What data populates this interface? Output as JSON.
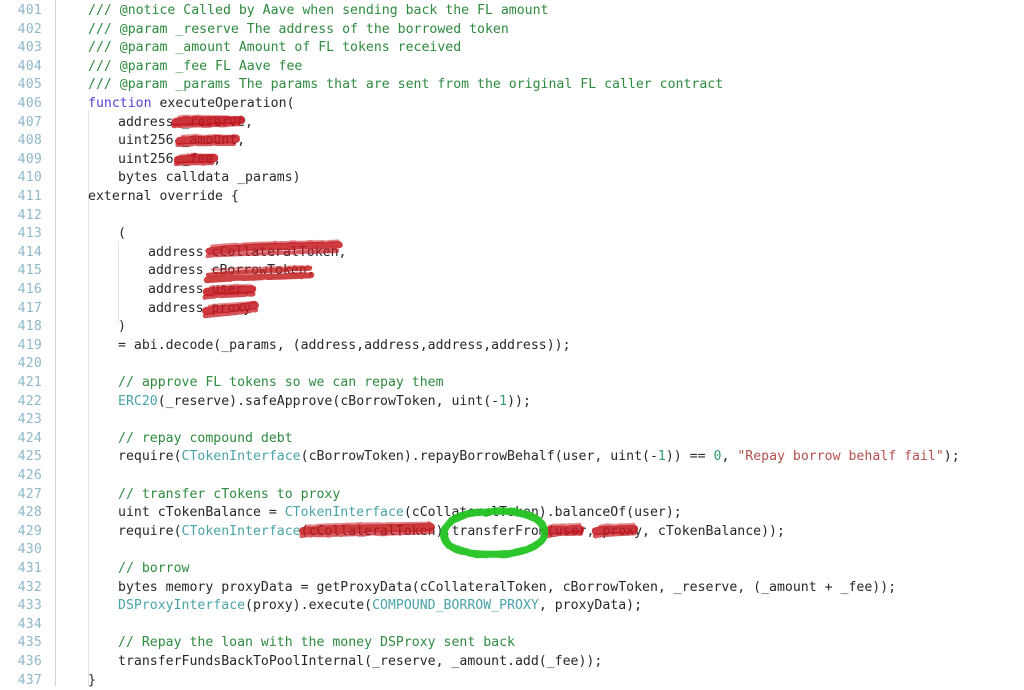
{
  "viewer": {
    "kind": "code-diff-viewer",
    "language": "solidity",
    "first_line_number": 401,
    "last_line_number": 437,
    "colors": {
      "background": "#ffffff",
      "line_number": "#8fb8c9",
      "gutter_border": "#cfd3d6",
      "indent_guide": "#e2e4e6",
      "text": "#24292e",
      "comment": "#2e8b3f",
      "keyword": "#5145d6",
      "type": "#4aa3a8",
      "string": "#b5514f",
      "number": "#2f9e6e",
      "annotation_red": "#c4161c",
      "annotation_green": "#22c522"
    }
  },
  "lines": [
    {
      "no": "401",
      "indent": 1,
      "tokens": [
        {
          "t": "/// @notice Called by Aave when sending back the FL amount",
          "c": "comment"
        }
      ]
    },
    {
      "no": "402",
      "indent": 1,
      "tokens": [
        {
          "t": "/// @param _reserve The address of the borrowed token",
          "c": "comment"
        }
      ]
    },
    {
      "no": "403",
      "indent": 1,
      "tokens": [
        {
          "t": "/// @param _amount Amount of FL tokens received",
          "c": "comment"
        }
      ]
    },
    {
      "no": "404",
      "indent": 1,
      "tokens": [
        {
          "t": "/// @param _fee FL Aave fee",
          "c": "comment"
        }
      ]
    },
    {
      "no": "405",
      "indent": 1,
      "tokens": [
        {
          "t": "/// @param _params The params that are sent from the original FL caller contract",
          "c": "comment"
        }
      ]
    },
    {
      "no": "406",
      "indent": 1,
      "tokens": [
        {
          "t": "function",
          "c": "keyword"
        },
        {
          "t": " executeOperation(",
          "c": "plain"
        }
      ]
    },
    {
      "no": "407",
      "indent": 2,
      "tokens": [
        {
          "t": "address _reserve,",
          "c": "plain"
        }
      ]
    },
    {
      "no": "408",
      "indent": 2,
      "tokens": [
        {
          "t": "uint256 _amount,",
          "c": "plain"
        }
      ]
    },
    {
      "no": "409",
      "indent": 2,
      "tokens": [
        {
          "t": "uint256 _fee,",
          "c": "plain"
        }
      ]
    },
    {
      "no": "410",
      "indent": 2,
      "tokens": [
        {
          "t": "bytes calldata _params)",
          "c": "plain"
        }
      ]
    },
    {
      "no": "411",
      "indent": 1,
      "tokens": [
        {
          "t": "external override {",
          "c": "plain"
        }
      ]
    },
    {
      "no": "412",
      "indent": 0,
      "tokens": []
    },
    {
      "no": "413",
      "indent": 2,
      "tokens": [
        {
          "t": "(",
          "c": "plain"
        }
      ]
    },
    {
      "no": "414",
      "indent": 3,
      "tokens": [
        {
          "t": "address cCollateralToken,",
          "c": "plain"
        }
      ]
    },
    {
      "no": "415",
      "indent": 3,
      "tokens": [
        {
          "t": "address cBorrowToken,",
          "c": "plain"
        }
      ]
    },
    {
      "no": "416",
      "indent": 3,
      "tokens": [
        {
          "t": "address user,",
          "c": "plain"
        }
      ]
    },
    {
      "no": "417",
      "indent": 3,
      "tokens": [
        {
          "t": "address proxy",
          "c": "plain"
        }
      ]
    },
    {
      "no": "418",
      "indent": 2,
      "tokens": [
        {
          "t": ")",
          "c": "plain"
        }
      ]
    },
    {
      "no": "419",
      "indent": 2,
      "tokens": [
        {
          "t": "= abi.decode(_params, (address,address,address,address));",
          "c": "plain"
        }
      ]
    },
    {
      "no": "420",
      "indent": 0,
      "tokens": []
    },
    {
      "no": "421",
      "indent": 2,
      "tokens": [
        {
          "t": "// approve FL tokens so we can repay them",
          "c": "comment"
        }
      ]
    },
    {
      "no": "422",
      "indent": 2,
      "tokens": [
        {
          "t": "ERC20",
          "c": "type"
        },
        {
          "t": "(_reserve).safeApprove(cBorrowToken, uint(-",
          "c": "plain"
        },
        {
          "t": "1",
          "c": "number"
        },
        {
          "t": "));",
          "c": "plain"
        }
      ]
    },
    {
      "no": "423",
      "indent": 0,
      "tokens": []
    },
    {
      "no": "424",
      "indent": 2,
      "tokens": [
        {
          "t": "// repay compound debt",
          "c": "comment"
        }
      ]
    },
    {
      "no": "425",
      "indent": 2,
      "tokens": [
        {
          "t": "require(",
          "c": "plain"
        },
        {
          "t": "CTokenInterface",
          "c": "type"
        },
        {
          "t": "(cBorrowToken).repayBorrowBehalf(user, uint(-",
          "c": "plain"
        },
        {
          "t": "1",
          "c": "number"
        },
        {
          "t": ")) == ",
          "c": "plain"
        },
        {
          "t": "0",
          "c": "number"
        },
        {
          "t": ", ",
          "c": "plain"
        },
        {
          "t": "\"Repay borrow behalf fail\"",
          "c": "string"
        },
        {
          "t": ");",
          "c": "plain"
        }
      ]
    },
    {
      "no": "426",
      "indent": 0,
      "tokens": []
    },
    {
      "no": "427",
      "indent": 2,
      "tokens": [
        {
          "t": "// transfer cTokens to proxy",
          "c": "comment"
        }
      ]
    },
    {
      "no": "428",
      "indent": 2,
      "tokens": [
        {
          "t": "uint cTokenBalance = ",
          "c": "plain"
        },
        {
          "t": "CTokenInterface",
          "c": "type"
        },
        {
          "t": "(cCollateralToken).balanceOf(user);",
          "c": "plain"
        }
      ]
    },
    {
      "no": "429",
      "indent": 2,
      "tokens": [
        {
          "t": "require(",
          "c": "plain"
        },
        {
          "t": "CTokenInterface",
          "c": "type"
        },
        {
          "t": "(cCollateralToken).transferFrom(user, proxy, cTokenBalance));",
          "c": "plain"
        }
      ]
    },
    {
      "no": "430",
      "indent": 0,
      "tokens": []
    },
    {
      "no": "431",
      "indent": 2,
      "tokens": [
        {
          "t": "// borrow",
          "c": "comment"
        }
      ]
    },
    {
      "no": "432",
      "indent": 2,
      "tokens": [
        {
          "t": "bytes memory proxyData = getProxyData(cCollateralToken, cBorrowToken, _reserve, (_amount + _fee));",
          "c": "plain"
        }
      ]
    },
    {
      "no": "433",
      "indent": 2,
      "tokens": [
        {
          "t": "DSProxyInterface",
          "c": "type"
        },
        {
          "t": "(proxy).execute(",
          "c": "plain"
        },
        {
          "t": "COMPOUND_BORROW_PROXY",
          "c": "type"
        },
        {
          "t": ", proxyData);",
          "c": "plain"
        }
      ]
    },
    {
      "no": "434",
      "indent": 0,
      "tokens": []
    },
    {
      "no": "435",
      "indent": 2,
      "tokens": [
        {
          "t": "// Repay the loan with the money DSProxy sent back",
          "c": "comment"
        }
      ]
    },
    {
      "no": "436",
      "indent": 2,
      "tokens": [
        {
          "t": "transferFundsBackToPoolInternal(_reserve, _amount.add(_fee));",
          "c": "plain"
        }
      ]
    },
    {
      "no": "437",
      "indent": 1,
      "tokens": [
        {
          "t": "}",
          "c": "plain"
        }
      ]
    }
  ],
  "annotations": {
    "red_strikeouts": [
      {
        "target": "_reserve",
        "line": "407"
      },
      {
        "target": "_amount",
        "line": "408"
      },
      {
        "target": "_fee",
        "line": "409"
      },
      {
        "target": "cCollateralToken",
        "line": "414"
      },
      {
        "target": "cBorrowToken",
        "line": "415"
      },
      {
        "target": "user",
        "line": "416"
      },
      {
        "target": "proxy",
        "line": "417"
      },
      {
        "target": "cCollateralToken",
        "line": "429"
      },
      {
        "target": "user",
        "line": "429"
      },
      {
        "target": "proxy",
        "line": "429"
      }
    ],
    "green_circles": [
      {
        "target": "transferFrom",
        "line": "429"
      }
    ]
  }
}
